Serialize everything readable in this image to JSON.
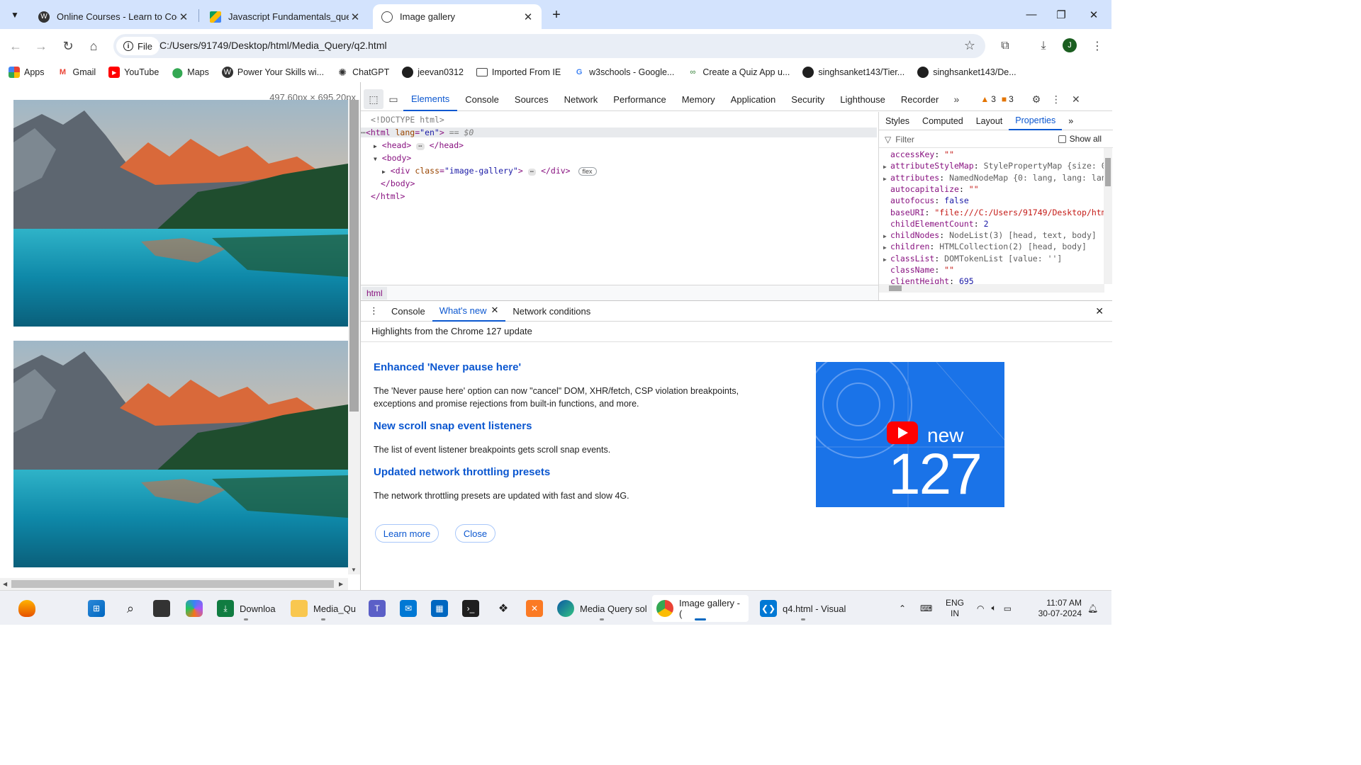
{
  "browser": {
    "tabs": [
      {
        "title": "Online Courses - Learn to Code",
        "icon": "wordpress-icon"
      },
      {
        "title": "Javascript Fundamentals_questi",
        "icon": "google-drive-icon"
      },
      {
        "title": "Image gallery",
        "icon": "globe-icon",
        "active": true
      }
    ],
    "address": {
      "chip": "File",
      "url": "C:/Users/91749/Desktop/html/Media_Query/q2.html"
    },
    "profile_initial": "J",
    "bookmarks": [
      {
        "label": "Apps",
        "icon": "apps-grid-icon"
      },
      {
        "label": "Gmail",
        "icon": "gmail-icon"
      },
      {
        "label": "YouTube",
        "icon": "youtube-icon"
      },
      {
        "label": "Maps",
        "icon": "maps-pin-icon"
      },
      {
        "label": "Power Your Skills wi...",
        "icon": "wordpress-icon"
      },
      {
        "label": "ChatGPT",
        "icon": "chatgpt-icon"
      },
      {
        "label": "jeevan0312",
        "icon": "github-icon"
      },
      {
        "label": "Imported From IE",
        "icon": "folder-icon"
      },
      {
        "label": "w3schools - Google...",
        "icon": "google-icon"
      },
      {
        "label": "Create a Quiz App u...",
        "icon": "link-icon"
      },
      {
        "label": "singhsanket143/Tier...",
        "icon": "github-icon"
      },
      {
        "label": "singhsanket143/De...",
        "icon": "github-icon"
      }
    ]
  },
  "page": {
    "dimension_tooltip": "497.60px × 695.20px"
  },
  "devtools": {
    "tabs": [
      "Elements",
      "Console",
      "Sources",
      "Network",
      "Performance",
      "Memory",
      "Application",
      "Security",
      "Lighthouse",
      "Recorder"
    ],
    "active_tab": "Elements",
    "warnings": "3",
    "issues": "3",
    "dom": {
      "doctype": "<!DOCTYPE html>",
      "html_open": "<html",
      "html_attr_name": "lang",
      "html_attr_value": "\"en\"",
      "html_selected": "== $0",
      "head": "<head>",
      "head_close": "</head>",
      "body_open": "<body>",
      "div_open": "<div",
      "div_attr_name": "class",
      "div_attr_value": "\"image-gallery\"",
      "div_close": "</div>",
      "div_badge": "flex",
      "body_close": "</body>",
      "html_close": "</html>"
    },
    "breadcrumb": "html",
    "side_tabs": [
      "Styles",
      "Computed",
      "Layout",
      "Properties"
    ],
    "active_side_tab": "Properties",
    "filter_placeholder": "Filter",
    "show_all": "Show all",
    "properties": [
      {
        "name": "accessKey",
        "value": "\"\"",
        "kind": "str",
        "expandable": false
      },
      {
        "name": "attributeStyleMap",
        "value": "StylePropertyMap {size: 0",
        "kind": "obj",
        "expandable": true
      },
      {
        "name": "attributes",
        "value": "NamedNodeMap {0: lang, lang: lan",
        "kind": "obj",
        "expandable": true
      },
      {
        "name": "autocapitalize",
        "value": "\"\"",
        "kind": "str",
        "expandable": false
      },
      {
        "name": "autofocus",
        "value": "false",
        "kind": "num",
        "expandable": false
      },
      {
        "name": "baseURI",
        "value": "\"file:///C:/Users/91749/Desktop/htm",
        "kind": "str",
        "expandable": false
      },
      {
        "name": "childElementCount",
        "value": "2",
        "kind": "num",
        "expandable": false
      },
      {
        "name": "childNodes",
        "value": "NodeList(3) [head, text, body]",
        "kind": "obj",
        "expandable": true
      },
      {
        "name": "children",
        "value": "HTMLCollection(2) [head, body]",
        "kind": "obj",
        "expandable": true
      },
      {
        "name": "classList",
        "value": "DOMTokenList [value: '']",
        "kind": "obj",
        "expandable": true
      },
      {
        "name": "className",
        "value": "\"\"",
        "kind": "str",
        "expandable": false
      },
      {
        "name": "clientHeight",
        "value": "695",
        "kind": "num",
        "expandable": false
      }
    ],
    "drawer": {
      "tabs": [
        "Console",
        "What's new",
        "Network conditions"
      ],
      "active": "What's new",
      "headline": "Highlights from the Chrome 127 update",
      "items": [
        {
          "title": "Enhanced 'Never pause here'",
          "body": "The 'Never pause here' option can now \"cancel\" DOM, XHR/fetch, CSP violation breakpoints, exceptions and promise rejections from built-in functions, and more."
        },
        {
          "title": "New scroll snap event listeners",
          "body": "The list of event listener breakpoints gets scroll snap events."
        },
        {
          "title": "Updated network throttling presets",
          "body": "The network throttling presets are updated with fast and slow 4G."
        }
      ],
      "learn_more": "Learn more",
      "close": "Close",
      "promo_new": "new",
      "promo_version": "127"
    }
  },
  "taskbar": {
    "items": [
      {
        "label": "Downloa",
        "icon": "downloads-icon"
      },
      {
        "label": "Media_Qu",
        "icon": "folder-icon"
      },
      {
        "label": "Media Query sol",
        "icon": "edge-icon"
      },
      {
        "label": "Image gallery - (",
        "icon": "chrome-icon"
      },
      {
        "label": "q4.html - Visual",
        "icon": "vscode-icon"
      }
    ],
    "lang_top": "ENG",
    "lang_bottom": "IN",
    "time": "11:07 AM",
    "date": "30-07-2024"
  },
  "colors": {
    "tabstrip": "#d3e3fd",
    "accent": "#0b57d0",
    "promo": "#1a73e8"
  }
}
